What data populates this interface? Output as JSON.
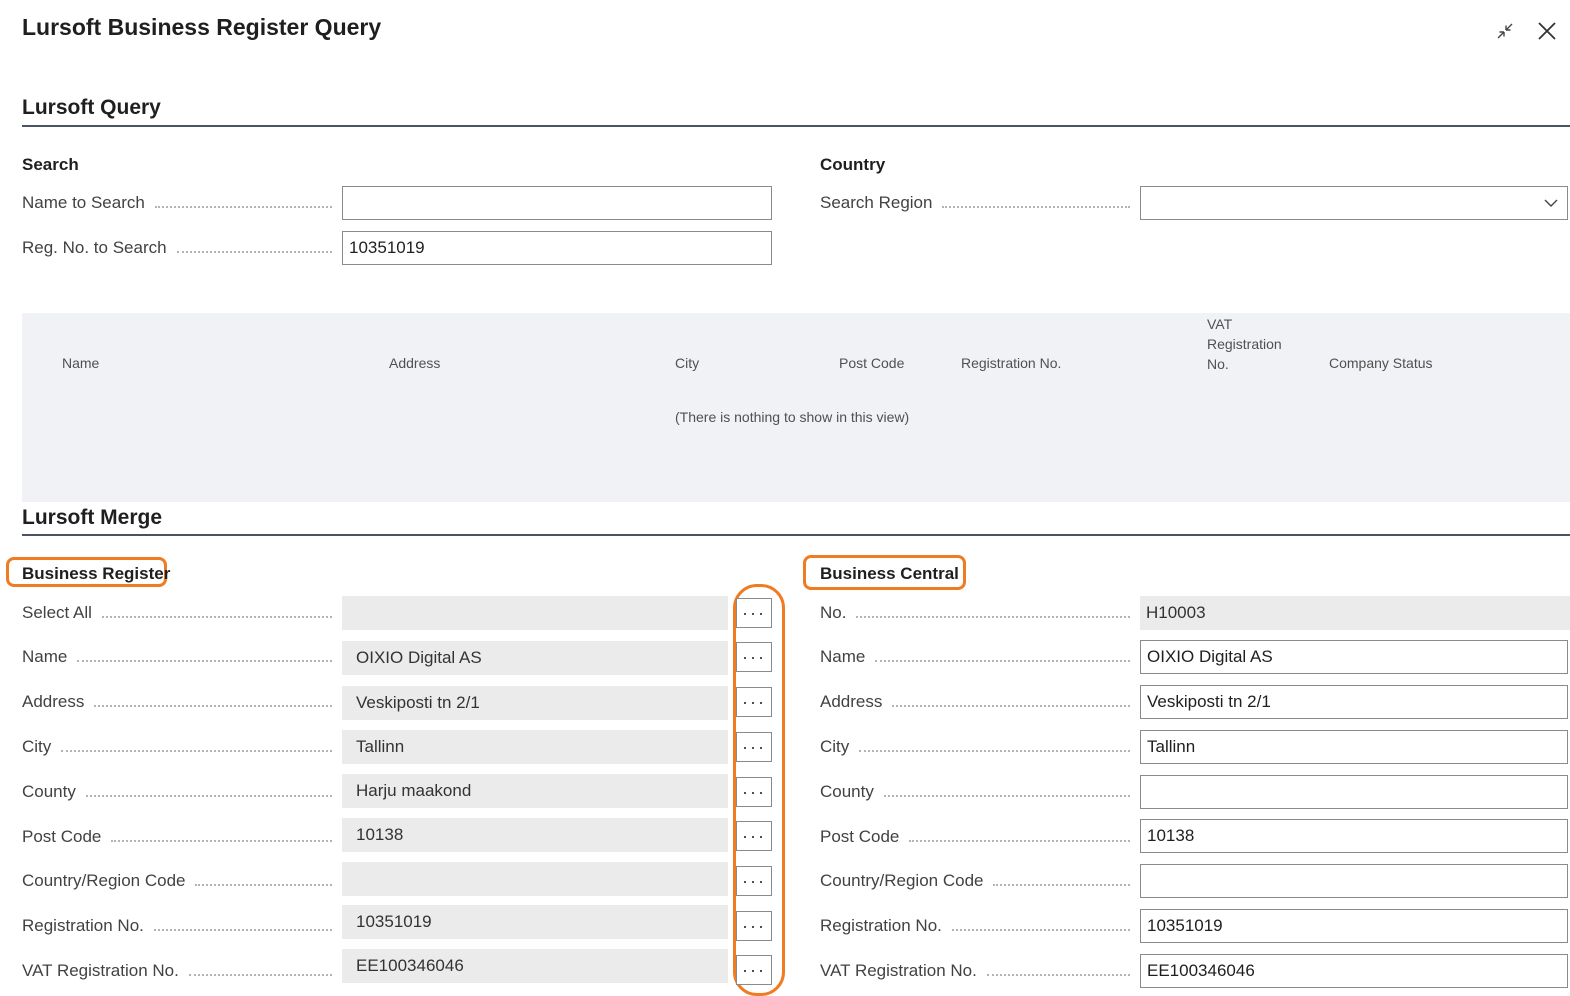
{
  "window": {
    "title": "Lursoft Business Register Query",
    "collapse_icon": "collapse-icon",
    "close_icon": "close-icon"
  },
  "query": {
    "section_title": "Lursoft Query",
    "search": {
      "group_title": "Search",
      "name_label": "Name to Search",
      "name_value": "",
      "regno_label": "Reg. No. to Search",
      "regno_value": "10351019"
    },
    "country": {
      "group_title": "Country",
      "region_label": "Search Region",
      "region_value": ""
    },
    "grid": {
      "columns": [
        "Name",
        "Address",
        "City",
        "Post Code",
        "Registration No.",
        "VAT Registration No.",
        "Company Status"
      ],
      "vat_header_lines": [
        "VAT",
        "Registration",
        "No."
      ],
      "empty_message": "(There is nothing to show in this view)"
    }
  },
  "merge": {
    "section_title": "Lursoft Merge",
    "business_register": {
      "group_title": "Business Register",
      "assist_label": "···",
      "rows": [
        {
          "label": "Select All",
          "value": ""
        },
        {
          "label": "Name",
          "value": "OIXIO Digital AS"
        },
        {
          "label": "Address",
          "value": "Veskiposti tn 2/1"
        },
        {
          "label": "City",
          "value": "Tallinn"
        },
        {
          "label": "County",
          "value": "Harju maakond"
        },
        {
          "label": "Post Code",
          "value": "10138"
        },
        {
          "label": "Country/Region Code",
          "value": ""
        },
        {
          "label": "Registration No.",
          "value": "10351019"
        },
        {
          "label": "VAT Registration No.",
          "value": "EE100346046"
        }
      ]
    },
    "business_central": {
      "group_title": "Business Central",
      "rows": [
        {
          "label": "No.",
          "value": "H10003"
        },
        {
          "label": "Name",
          "value": "OIXIO Digital AS"
        },
        {
          "label": "Address",
          "value": "Veskiposti tn 2/1"
        },
        {
          "label": "City",
          "value": "Tallinn"
        },
        {
          "label": "County",
          "value": ""
        },
        {
          "label": "Post Code",
          "value": "10138"
        },
        {
          "label": "Country/Region Code",
          "value": ""
        },
        {
          "label": "Registration No.",
          "value": "10351019"
        },
        {
          "label": "VAT Registration No.",
          "value": "EE100346046"
        }
      ]
    }
  },
  "colors": {
    "highlight": "#f07b21",
    "rule": "#4a5361",
    "grid_bg": "#f0f2f5",
    "readonly_bg": "#ebebeb"
  }
}
